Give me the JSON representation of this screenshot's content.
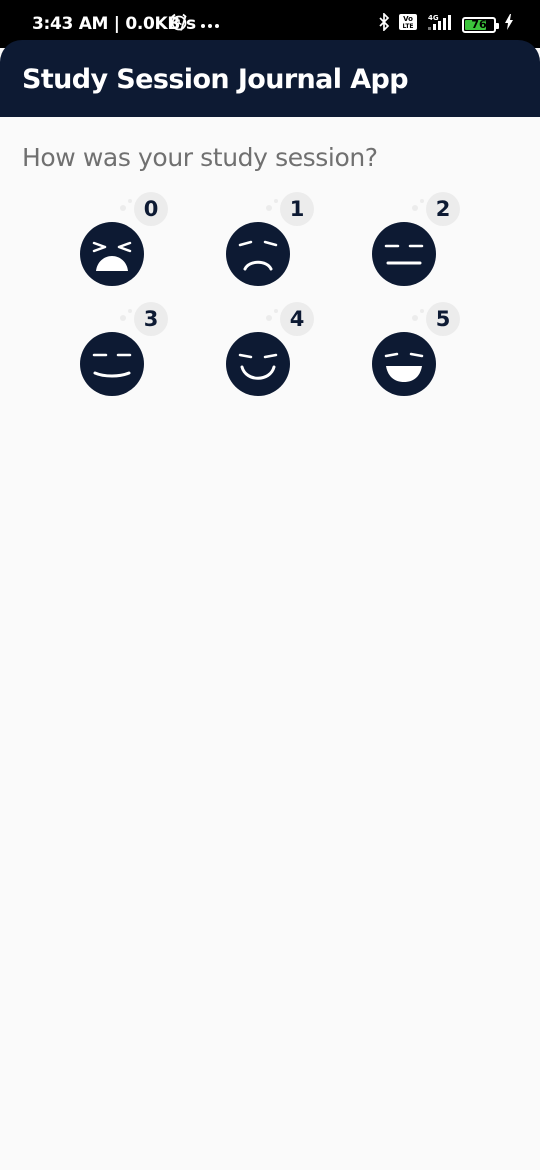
{
  "status_bar": {
    "time": "3:43 AM | 0.0KB/s",
    "battery_level": "76",
    "battery_fraction": 0.76,
    "network": "4G",
    "icons": [
      "alarm-icon",
      "more-dots-icon",
      "bluetooth-icon",
      "volte-icon",
      "signal-icon",
      "battery-icon",
      "charging-icon"
    ]
  },
  "app_bar": {
    "title": "Study Session Journal App",
    "background": "#0d1a33"
  },
  "main": {
    "question": "How was your study session?",
    "moods": [
      {
        "value": "0",
        "icon": "crying-face-icon"
      },
      {
        "value": "1",
        "icon": "sad-face-icon"
      },
      {
        "value": "2",
        "icon": "neutral-face-icon"
      },
      {
        "value": "3",
        "icon": "slight-smile-face-icon"
      },
      {
        "value": "4",
        "icon": "smiling-face-icon"
      },
      {
        "value": "5",
        "icon": "laughing-face-icon"
      }
    ]
  },
  "colors": {
    "accent": "#0d1a33",
    "badge": "#ececec",
    "question_text": "#707070",
    "background": "#fafafa"
  }
}
